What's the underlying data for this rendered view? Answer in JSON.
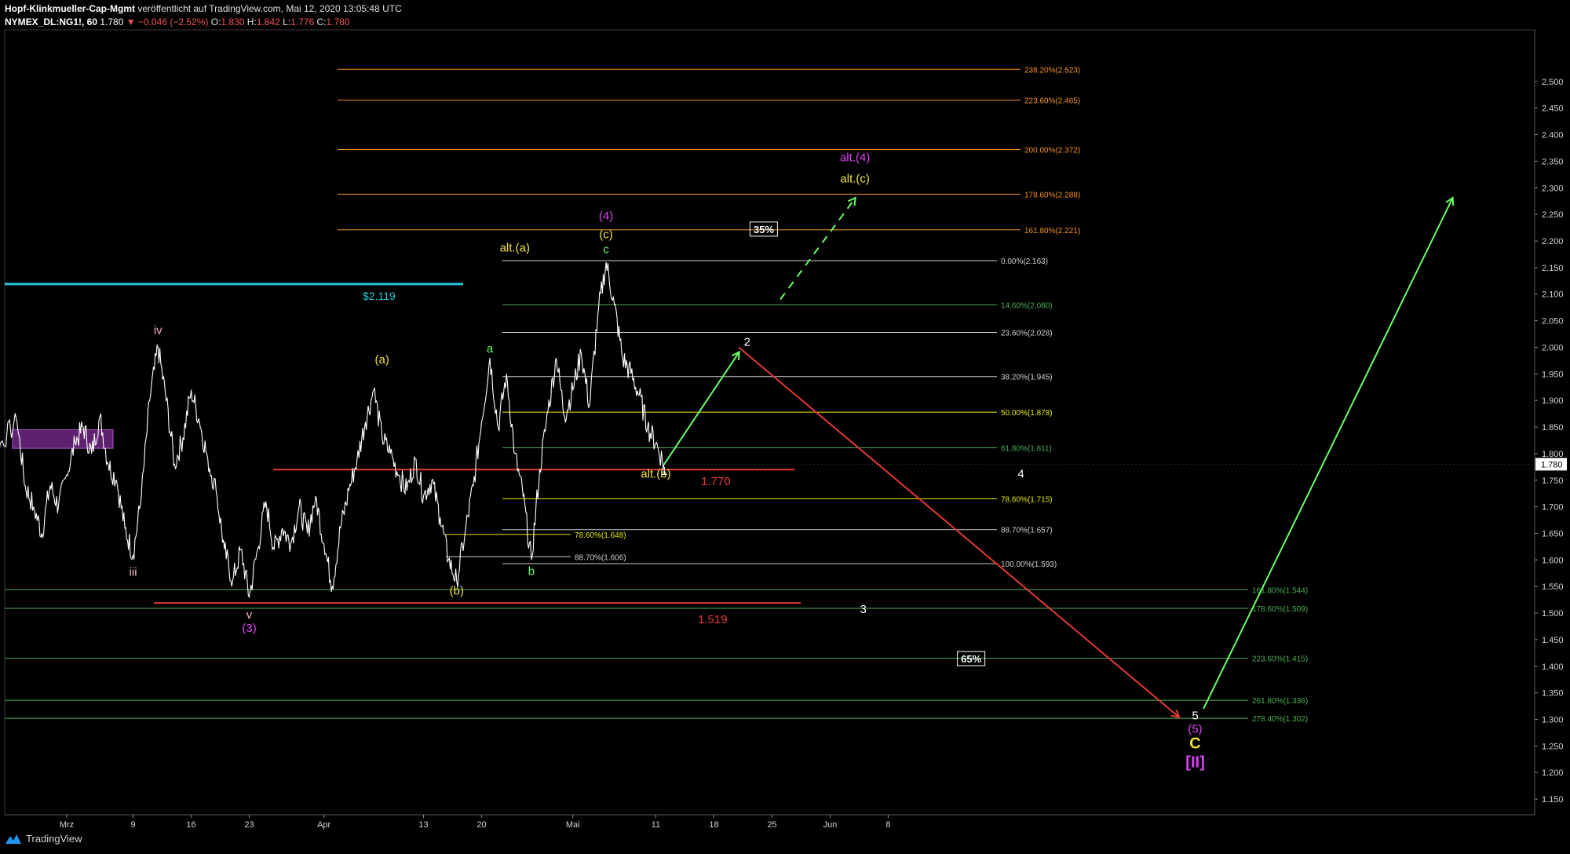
{
  "header": {
    "author": "Hopf-Klinkmueller-Cap-Mgmt",
    "published_text": "veröffentlicht auf TradingView.com, Mai 12, 2020 13:05:48 UTC",
    "symbol": "NYMEX_DL:NG1!, 60",
    "last_price": "1.780",
    "change": "−0.046 (−2.52%)",
    "open": "1.830",
    "high": "1.842",
    "low": "1.776",
    "close": "1.780"
  },
  "branding": {
    "logo_text": "TradingView"
  },
  "colors": {
    "background": "#000000",
    "price_line": "#ffffff",
    "fib_white": "#d0d0d0",
    "fib_green": "#4caf50",
    "fib_yellow": "#e8e800",
    "fib_orange": "#f7931e",
    "level_red": "#e53935",
    "cyan": "#26c6da",
    "magenta": "#e040fb",
    "wave_yellow": "#f0e040",
    "wave_green": "#66ff66"
  },
  "chart_data": {
    "type": "line",
    "title": "",
    "ylim": [
      1.125,
      2.55
    ],
    "y_ticks": [
      "2.500",
      "2.450",
      "2.400",
      "2.350",
      "2.300",
      "2.250",
      "2.200",
      "2.150",
      "2.100",
      "2.050",
      "2.000",
      "1.950",
      "1.900",
      "1.850",
      "1.800",
      "1.750",
      "1.700",
      "1.650",
      "1.600",
      "1.550",
      "1.500",
      "1.450",
      "1.400",
      "1.350",
      "1.300",
      "1.250",
      "1.200",
      "1.150"
    ],
    "x_ticks": [
      {
        "label": "Mrz",
        "date": "2020-03-01"
      },
      {
        "label": "9",
        "date": "2020-03-09"
      },
      {
        "label": "16",
        "date": "2020-03-16"
      },
      {
        "label": "23",
        "date": "2020-03-23"
      },
      {
        "label": "Apr",
        "date": "2020-04-01"
      },
      {
        "label": "13",
        "date": "2020-04-13"
      },
      {
        "label": "20",
        "date": "2020-04-20"
      },
      {
        "label": "Mai",
        "date": "2020-05-01"
      },
      {
        "label": "11",
        "date": "2020-05-11"
      },
      {
        "label": "18",
        "date": "2020-05-18"
      },
      {
        "label": "25",
        "date": "2020-05-25"
      },
      {
        "label": "Jun",
        "date": "2020-06-01"
      },
      {
        "label": "8",
        "date": "2020-06-08"
      }
    ],
    "series": [
      {
        "values": [
          [
            "2020-02-20",
            1.93
          ],
          [
            "2020-02-21",
            1.86
          ],
          [
            "2020-02-22",
            1.82
          ],
          [
            "2020-02-24",
            1.86
          ],
          [
            "2020-02-25",
            1.74
          ],
          [
            "2020-02-26",
            1.7
          ],
          [
            "2020-02-27",
            1.65
          ],
          [
            "2020-02-28",
            1.74
          ],
          [
            "2020-02-29",
            1.7
          ],
          [
            "2020-03-01",
            1.76
          ],
          [
            "2020-03-02",
            1.82
          ],
          [
            "2020-03-03",
            1.85
          ],
          [
            "2020-03-04",
            1.8
          ],
          [
            "2020-03-05",
            1.87
          ],
          [
            "2020-03-06",
            1.78
          ],
          [
            "2020-03-07",
            1.75
          ],
          [
            "2020-03-08",
            1.66
          ],
          [
            "2020-03-09",
            1.61
          ],
          [
            "2020-03-10",
            1.72
          ],
          [
            "2020-03-11",
            1.9
          ],
          [
            "2020-03-12",
            2.0
          ],
          [
            "2020-03-13",
            1.9
          ],
          [
            "2020-03-14",
            1.78
          ],
          [
            "2020-03-15",
            1.83
          ],
          [
            "2020-03-16",
            1.92
          ],
          [
            "2020-03-17",
            1.86
          ],
          [
            "2020-03-18",
            1.79
          ],
          [
            "2020-03-19",
            1.73
          ],
          [
            "2020-03-20",
            1.62
          ],
          [
            "2020-03-21",
            1.56
          ],
          [
            "2020-03-22",
            1.62
          ],
          [
            "2020-03-23",
            1.53
          ],
          [
            "2020-03-24",
            1.62
          ],
          [
            "2020-03-25",
            1.71
          ],
          [
            "2020-03-26",
            1.62
          ],
          [
            "2020-03-27",
            1.66
          ],
          [
            "2020-03-28",
            1.63
          ],
          [
            "2020-03-29",
            1.7
          ],
          [
            "2020-03-30",
            1.65
          ],
          [
            "2020-03-31",
            1.72
          ],
          [
            "2020-04-01",
            1.63
          ],
          [
            "2020-04-02",
            1.55
          ],
          [
            "2020-04-03",
            1.66
          ],
          [
            "2020-04-04",
            1.73
          ],
          [
            "2020-04-05",
            1.79
          ],
          [
            "2020-04-06",
            1.86
          ],
          [
            "2020-04-07",
            1.92
          ],
          [
            "2020-04-08",
            1.83
          ],
          [
            "2020-04-09",
            1.8
          ],
          [
            "2020-04-10",
            1.76
          ],
          [
            "2020-04-11",
            1.73
          ],
          [
            "2020-04-12",
            1.79
          ],
          [
            "2020-04-13",
            1.72
          ],
          [
            "2020-04-14",
            1.75
          ],
          [
            "2020-04-15",
            1.68
          ],
          [
            "2020-04-16",
            1.6
          ],
          [
            "2020-04-17",
            1.56
          ],
          [
            "2020-04-18",
            1.65
          ],
          [
            "2020-04-19",
            1.74
          ],
          [
            "2020-04-20",
            1.86
          ],
          [
            "2020-04-21",
            1.98
          ],
          [
            "2020-04-22",
            1.85
          ],
          [
            "2020-04-23",
            1.95
          ],
          [
            "2020-04-24",
            1.8
          ],
          [
            "2020-04-25",
            1.72
          ],
          [
            "2020-04-26",
            1.6
          ],
          [
            "2020-04-27",
            1.77
          ],
          [
            "2020-04-28",
            1.88
          ],
          [
            "2020-04-29",
            1.98
          ],
          [
            "2020-04-30",
            1.87
          ],
          [
            "2020-05-01",
            1.92
          ],
          [
            "2020-05-02",
            1.99
          ],
          [
            "2020-05-03",
            1.89
          ],
          [
            "2020-05-04",
            2.06
          ],
          [
            "2020-05-05",
            2.16
          ],
          [
            "2020-05-06",
            2.08
          ],
          [
            "2020-05-07",
            1.98
          ],
          [
            "2020-05-08",
            1.95
          ],
          [
            "2020-05-09",
            1.91
          ],
          [
            "2020-05-10",
            1.85
          ],
          [
            "2020-05-11",
            1.82
          ],
          [
            "2020-05-12",
            1.78
          ]
        ]
      }
    ],
    "fibonacci_levels": [
      {
        "label": "238.20%(2.523)",
        "value": 2.523,
        "color": "#f7931e"
      },
      {
        "label": "223.60%(2.465)",
        "value": 2.465,
        "color": "#f7931e"
      },
      {
        "label": "200.00%(2.372)",
        "value": 2.372,
        "color": "#f7931e"
      },
      {
        "label": "178.60%(2.288)",
        "value": 2.288,
        "color": "#f7931e"
      },
      {
        "label": "161.80%(2.221)",
        "value": 2.221,
        "color": "#f7931e"
      },
      {
        "label": "0.00%(2.163)",
        "value": 2.163,
        "color": "#d0d0d0"
      },
      {
        "label": "14.60%(2.080)",
        "value": 2.08,
        "color": "#4caf50"
      },
      {
        "label": "23.60%(2.028)",
        "value": 2.028,
        "color": "#d0d0d0"
      },
      {
        "label": "38.20%(1.945)",
        "value": 1.945,
        "color": "#d0d0d0"
      },
      {
        "label": "50.00%(1.878)",
        "value": 1.878,
        "color": "#e8e800"
      },
      {
        "label": "61.80%(1.811)",
        "value": 1.811,
        "color": "#4caf50"
      },
      {
        "label": "78.60%(1.715)",
        "value": 1.715,
        "color": "#e8e800"
      },
      {
        "label": "88.70%(1.657)",
        "value": 1.657,
        "color": "#d0d0d0"
      },
      {
        "label": "100.00%(1.593)",
        "value": 1.593,
        "color": "#d0d0d0"
      },
      {
        "label": "78.60%(1.648)",
        "value": 1.648,
        "color": "#e8e800"
      },
      {
        "label": "88.70%(1.606)",
        "value": 1.606,
        "color": "#d0d0d0"
      },
      {
        "label": "161.80%(1.544)",
        "value": 1.544,
        "color": "#4caf50"
      },
      {
        "label": "178.60%(1.509)",
        "value": 1.509,
        "color": "#4caf50"
      },
      {
        "label": "223.60%(1.415)",
        "value": 1.415,
        "color": "#4caf50"
      },
      {
        "label": "261.80%(1.336)",
        "value": 1.336,
        "color": "#4caf50"
      },
      {
        "label": "278.40%(1.302)",
        "value": 1.302,
        "color": "#4caf50"
      }
    ],
    "horizontal_levels": [
      {
        "label": "$2.119",
        "value": 2.119,
        "color": "#26c6da"
      },
      {
        "label": "1.770",
        "value": 1.77,
        "color": "#e53935"
      },
      {
        "label": "1.519",
        "value": 1.519,
        "color": "#e53935"
      }
    ],
    "wave_labels": [
      {
        "text": "iv",
        "date": "2020-03-12",
        "value": 2.025,
        "color": "#f8b4c4"
      },
      {
        "text": "iii",
        "date": "2020-03-09",
        "value": 1.57,
        "color": "#f8b4c4"
      },
      {
        "text": "v",
        "date": "2020-03-23",
        "value": 1.49,
        "color": "#f8b4c4"
      },
      {
        "text": "(3)",
        "date": "2020-03-23",
        "value": 1.465,
        "color": "#e040fb"
      },
      {
        "text": "(a)",
        "date": "2020-04-08",
        "value": 1.97,
        "color": "#f0e040"
      },
      {
        "text": "(b)",
        "date": "2020-04-17",
        "value": 1.535,
        "color": "#f0e040"
      },
      {
        "text": "a",
        "date": "2020-04-21",
        "value": 1.99,
        "color": "#66ff66"
      },
      {
        "text": "b",
        "date": "2020-04-26",
        "value": 1.572,
        "color": "#66ff66"
      },
      {
        "text": "alt.(a)",
        "date": "2020-04-24",
        "value": 2.18,
        "color": "#f0e040"
      },
      {
        "text": "c",
        "date": "2020-05-05",
        "value": 2.177,
        "color": "#66ff66"
      },
      {
        "text": "(c)",
        "date": "2020-05-05",
        "value": 2.205,
        "color": "#f0e040"
      },
      {
        "text": "(4)",
        "date": "2020-05-05",
        "value": 2.24,
        "color": "#e040fb"
      },
      {
        "text": "alt.(b)",
        "date": "2020-05-11",
        "value": 1.755,
        "color": "#f0e040"
      },
      {
        "text": "1",
        "date": "2020-05-12",
        "value": 1.76,
        "color": "#ffffff"
      },
      {
        "text": "2",
        "date": "2020-05-22",
        "value": 2.003,
        "color": "#ffffff"
      },
      {
        "text": "3",
        "date": "2020-06-05",
        "value": 1.5,
        "color": "#ffffff"
      },
      {
        "text": "4",
        "date": "2020-06-24",
        "value": 1.755,
        "color": "#ffffff"
      },
      {
        "text": "5",
        "date": "2020-07-15",
        "value": 1.3,
        "color": "#ffffff"
      },
      {
        "text": "(5)",
        "date": "2020-07-15",
        "value": 1.275,
        "color": "#e040fb"
      },
      {
        "text": "C",
        "date": "2020-07-15",
        "value": 1.245,
        "color": "#f0e040"
      },
      {
        "text": "[II]",
        "date": "2020-07-15",
        "value": 1.21,
        "color": "#e040fb"
      },
      {
        "text": "alt.(4)",
        "date": "2020-06-04",
        "value": 2.35,
        "color": "#e040fb"
      },
      {
        "text": "alt.(c)",
        "date": "2020-06-04",
        "value": 2.31,
        "color": "#f0e040"
      },
      {
        "text": "35%",
        "date": "2020-05-24",
        "value": 2.215,
        "color": "#ffffff",
        "boxed": true
      },
      {
        "text": "65%",
        "date": "2020-06-18",
        "value": 1.407,
        "color": "#ffffff",
        "boxed": true
      }
    ],
    "projections": [
      {
        "name": "wave 2 up",
        "from": [
          "2020-05-12",
          1.78
        ],
        "to": [
          "2020-05-21",
          1.99
        ],
        "color": "#66ff66",
        "dashed": false
      },
      {
        "name": "wave down to 5",
        "from": [
          "2020-05-21",
          2.0
        ],
        "to": [
          "2020-07-13",
          1.305
        ],
        "color": "#e53935",
        "dashed": false
      },
      {
        "name": "alt up",
        "from": [
          "2020-05-26",
          2.09
        ],
        "to": [
          "2020-06-04",
          2.28
        ],
        "color": "#66ff66",
        "dashed": true
      },
      {
        "name": "wave up after 5",
        "from": [
          "2020-07-16",
          1.32
        ],
        "to": [
          "2020-08-15",
          2.28
        ],
        "color": "#66ff66",
        "dashed": false
      }
    ],
    "last_price_tag": "1.780"
  }
}
